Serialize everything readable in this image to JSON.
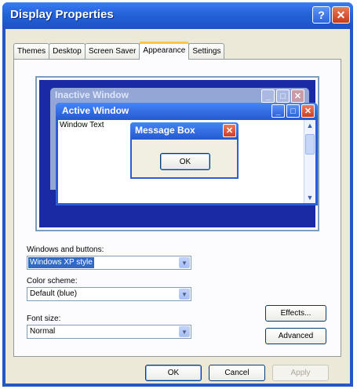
{
  "window": {
    "title": "Display Properties",
    "help_icon_label": "?",
    "close_icon_label": "✕"
  },
  "tabs": [
    {
      "label": "Themes"
    },
    {
      "label": "Desktop"
    },
    {
      "label": "Screen Saver"
    },
    {
      "label": "Appearance",
      "active": true
    },
    {
      "label": "Settings"
    }
  ],
  "preview": {
    "inactive_title": "Inactive Window",
    "active_title": "Active Window",
    "window_text": "Window Text",
    "message_box_title": "Message Box",
    "message_box_ok": "OK",
    "minimize_glyph": "_",
    "maximize_glyph": "□",
    "close_glyph": "✕",
    "scroll_up_glyph": "▲",
    "scroll_down_glyph": "▼"
  },
  "appearance": {
    "windows_buttons_label": "Windows and buttons:",
    "windows_buttons_value": "Windows XP style",
    "color_scheme_label": "Color scheme:",
    "color_scheme_value": "Default (blue)",
    "font_size_label": "Font size:",
    "font_size_value": "Normal",
    "effects_button": "Effects...",
    "advanced_button": "Advanced",
    "dropdown_glyph": "▼"
  },
  "footer": {
    "ok": "OK",
    "cancel": "Cancel",
    "apply": "Apply"
  },
  "colors": {
    "titlebar": "#2462d8",
    "dialog_face": "#ece9d8",
    "desktop_preview": "#1a2aa5",
    "selection": "#316ac5",
    "close_button": "#cc4020"
  }
}
